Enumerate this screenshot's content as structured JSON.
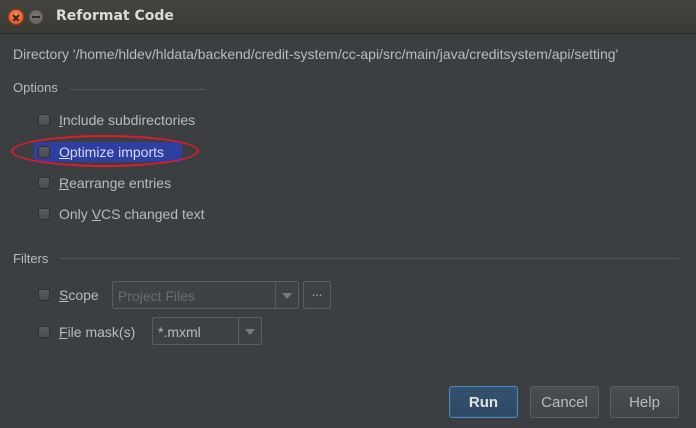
{
  "window": {
    "title": "Reformat Code",
    "directory_text": "Directory '/home/hldev/hldata/backend/credit-system/cc-api/src/main/java/creditsystem/api/setting'"
  },
  "options": {
    "label": "Options",
    "items": [
      {
        "mnemonic": "I",
        "rest": "nclude subdirectories",
        "checked": false
      },
      {
        "mnemonic": "O",
        "rest": "ptimize imports",
        "checked": false,
        "highlighted": true
      },
      {
        "mnemonic": "R",
        "rest": "earrange entries",
        "checked": false
      },
      {
        "prefix": "Only ",
        "mnemonic": "V",
        "rest": "CS changed text",
        "checked": false
      }
    ]
  },
  "filters": {
    "label": "Filters",
    "scope": {
      "mnemonic": "S",
      "rest": "cope",
      "checked": false,
      "value": "Project Files",
      "browse_label": "..."
    },
    "file_mask": {
      "mnemonic": "F",
      "rest": "ile mask(s)",
      "checked": false,
      "value": "*.mxml"
    }
  },
  "buttons": {
    "run": "Run",
    "cancel": "Cancel",
    "help": "Help"
  },
  "colors": {
    "background": "#3c3f41",
    "highlight": "#2f3f9f",
    "annotation_oval": "#e01b2a",
    "primary_border": "#4f88bd"
  }
}
